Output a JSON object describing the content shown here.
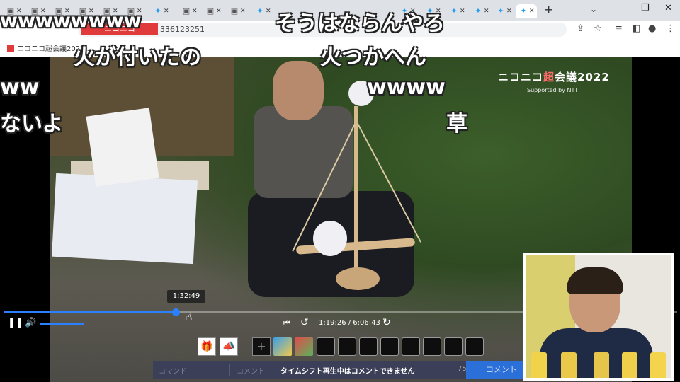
{
  "browser": {
    "url_suffix": "336123251",
    "site_logo_text": "ニコニコ",
    "bookmark_label": "ニコニコ超会議2022...",
    "tab_add_glyph": "+",
    "tab_dropdown_glyph": "⌄"
  },
  "video": {
    "watermark_main": "ニコニコ",
    "watermark_chou": "超",
    "watermark_rest": "会議2022",
    "watermark_sub": "Supported by NTT"
  },
  "comments": [
    {
      "text": "wwwwwwww"
    },
    {
      "text": "そうはならんやろ"
    },
    {
      "text": "火が付いたの"
    },
    {
      "text": "火つかへん"
    },
    {
      "text": "ww"
    },
    {
      "text": "wwww"
    },
    {
      "text": "ないよ"
    },
    {
      "text": "草"
    }
  ],
  "player": {
    "seek_tooltip": "1:32:49",
    "progress_percent": 25.5,
    "time_display": "1:19:26 / 6:06:43",
    "comment_command_placeholder": "コマンド",
    "comment_placeholder": "コメント",
    "comment_disabled_message": "タイムシフト再生中はコメントできません",
    "comment_char_count": "75",
    "comment_submit_label": "コメント"
  },
  "icons": {
    "pause": "pause-icon",
    "volume": "volume-icon",
    "prev": "skip-previous-icon",
    "back10": "rewind-10-icon",
    "fwd10": "forward-10-icon",
    "gift": "gift-icon",
    "ad": "megaphone-icon",
    "plus": "plus-icon"
  },
  "colors": {
    "accent": "#2a80ff",
    "comment_bar": "#3b3f57",
    "submit": "#2b6fd9"
  }
}
